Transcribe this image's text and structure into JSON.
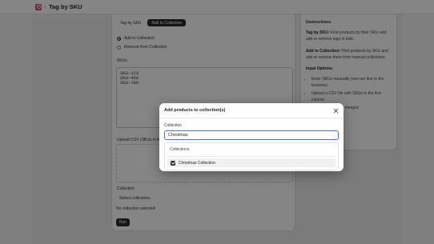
{
  "app": {
    "title": "Tag by SKU",
    "separator": "›"
  },
  "tabs": [
    {
      "label": "Tag by SKU"
    },
    {
      "label": "Add to Collection"
    }
  ],
  "mode_options": [
    {
      "label": "Add to Collection",
      "selected": true
    },
    {
      "label": "Remove from Collection",
      "selected": false
    }
  ],
  "skus": {
    "label": "SKUs",
    "value": "SKU-123\nSKU-456\nSKU-789"
  },
  "csv": {
    "label": "Upload CSV (SKUs in first column)"
  },
  "collection": {
    "label": "Collection",
    "select_label": "Select collections",
    "status": "No collection selected"
  },
  "run_label": "Run",
  "instructions": {
    "title": "Instructions",
    "tag_term": "Tag by SKU:",
    "tag_text": " Find products by their SKU and add or remove tags in bulk.",
    "add_term": "Add to Collection:",
    "add_text": " Find products by SKU and add or remove them from manual collections.",
    "input_title": "Input Options:",
    "items": [
      "Enter SKUs manually (one per line in the textarea)",
      "Upload a CSV file with SKUs in the first column",
      "Both inputs will be merged"
    ]
  },
  "modal": {
    "title": "Add products to collection(s)",
    "field_label": "Collection",
    "field_value": "Christmas",
    "list_heading": "Collections",
    "options": [
      {
        "label": "Christmas Collection",
        "checked": true
      }
    ]
  }
}
